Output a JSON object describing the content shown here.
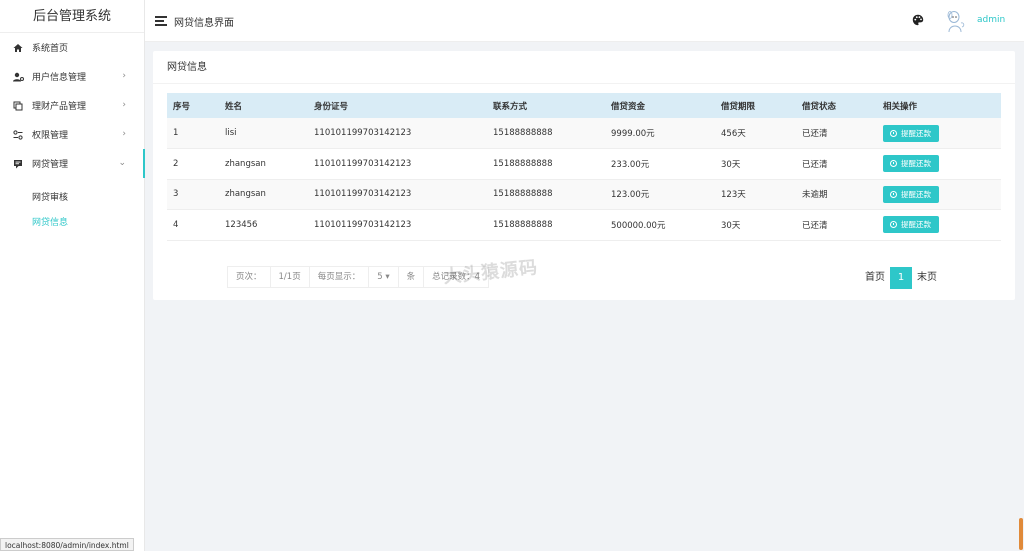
{
  "app": {
    "title": "后台管理系统"
  },
  "sidebar": {
    "items": [
      {
        "label": "系统首页",
        "icon": "home-icon",
        "arrow": ""
      },
      {
        "label": "用户信息管理",
        "icon": "user-settings-icon",
        "arrow": "›"
      },
      {
        "label": "理财产品管理",
        "icon": "finance-icon",
        "arrow": "›"
      },
      {
        "label": "权限管理",
        "icon": "permission-icon",
        "arrow": "›"
      },
      {
        "label": "网贷管理",
        "icon": "loan-icon",
        "arrow": "⌄"
      }
    ],
    "submenu": [
      {
        "label": "网贷审核"
      },
      {
        "label": "网贷信息"
      }
    ]
  },
  "header": {
    "title": "网贷信息界面",
    "user": "admin"
  },
  "card": {
    "title": "网贷信息",
    "columns": [
      "序号",
      "姓名",
      "身份证号",
      "联系方式",
      "借贷资金",
      "借贷期限",
      "借贷状态",
      "相关操作"
    ],
    "rows": [
      {
        "no": "1",
        "name": "lisi",
        "id_number": "110101199703142123",
        "phone": "15188888888",
        "amount": "9999.00元",
        "term": "456天",
        "status": "已还清",
        "action": "提醒还款"
      },
      {
        "no": "2",
        "name": "zhangsan",
        "id_number": "110101199703142123",
        "phone": "15188888888",
        "amount": "233.00元",
        "term": "30天",
        "status": "已还清",
        "action": "提醒还款"
      },
      {
        "no": "3",
        "name": "zhangsan",
        "id_number": "110101199703142123",
        "phone": "15188888888",
        "amount": "123.00元",
        "term": "123天",
        "status": "未逾期",
        "action": "提醒还款"
      },
      {
        "no": "4",
        "name": "123456",
        "id_number": "110101199703142123",
        "phone": "15188888888",
        "amount": "500000.00元",
        "term": "30天",
        "status": "已还清",
        "action": "提醒还款"
      }
    ]
  },
  "pagination": {
    "page_label": "页次：",
    "page_value": "1/1页",
    "per_page_label": "每页显示：",
    "per_page_value": "5",
    "per_page_unit": "条",
    "total_label": "总记录数：",
    "total_value": "4",
    "first": "首页",
    "current": "1",
    "last": "末页"
  },
  "watermark": "大头猿源码",
  "statusbar": {
    "url": "localhost:8080/admin/index.html"
  },
  "colors": {
    "accent": "#2ec7c9",
    "table_header": "#d9ecf6"
  }
}
